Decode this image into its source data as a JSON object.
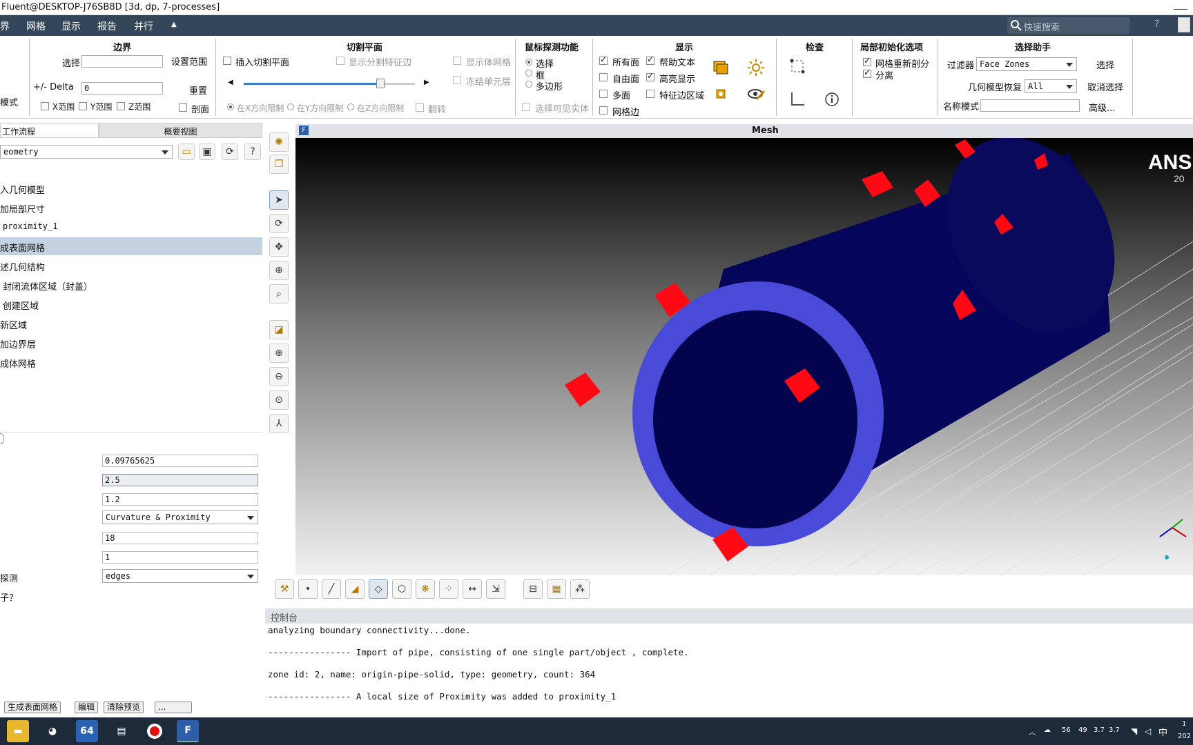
{
  "window": {
    "title": "Fluent@DESKTOP-J76SB8D  [3d, dp, 7-processes]"
  },
  "menu": {
    "items": [
      "界",
      "网格",
      "显示",
      "报告",
      "并行"
    ],
    "search_placeholder": "快速搜索"
  },
  "ribbon": {
    "boundary": {
      "title": "边界",
      "select_label": "选择",
      "set_range": "设置范围",
      "delta_label": "+/- Delta",
      "delta_value": "0",
      "reset": "重置",
      "mode_label": "模式",
      "x_range": "X范围",
      "y_range": "Y范围",
      "z_range": "Z范围",
      "section": "剖面"
    },
    "cutplane": {
      "title": "切割平面",
      "insert": "插入切割平面",
      "show_feature": "显示分割特征边",
      "x_limit": "在X方向限制",
      "y_limit": "在Y方向限制",
      "z_limit": "在Z方向限制",
      "show_mesh": "显示体网格",
      "freeze": "冻结单元层",
      "flip": "翻转",
      "slider_value": 0.8
    },
    "probe": {
      "title": "鼠标探测功能",
      "select": "选择",
      "box": "框",
      "polygon": "多边形",
      "visible_only": "选择可见实体"
    },
    "display": {
      "title": "显示",
      "all_faces": "所有面",
      "free_faces": "自由面",
      "multi_faces": "多面",
      "mesh_edges": "网格边",
      "help_text": "帮助文本",
      "highlight": "高亮显示",
      "feature_edges": "特征边区域"
    },
    "check": {
      "title": "检查"
    },
    "local_init": {
      "title": "局部初始化选项",
      "remesh": "网格重新剖分",
      "separate": "分离"
    },
    "selection_helper": {
      "title": "选择助手",
      "filter_label": "过滤器",
      "filter_value": "Face Zones",
      "select_btn": "选择",
      "geom_restore_label": "几何模型恢复",
      "geom_restore_value": "All",
      "deselect_btn": "取消选择",
      "name_mode_label": "名称模式",
      "advanced_btn": "高级..."
    }
  },
  "left": {
    "tab_workflow": "工作流程",
    "tab_overview": "概要视图",
    "workflow_select": "eometry",
    "tree": [
      "入几何模型",
      "加局部尺寸",
      "proximity_1",
      "成表面网格",
      "述几何结构",
      "封闭流体区域（封盖）",
      "创建区域",
      "新区域",
      "加边界层",
      "成体网格"
    ],
    "fields": [
      "0.09765625",
      "2.5",
      "1.2",
      "Curvature & Proximity",
      "18",
      "1",
      "edges"
    ],
    "label_probe": "探测",
    "label_q": "子？",
    "buttons": [
      "生成表面网格",
      "编辑",
      "清除预览",
      "..."
    ]
  },
  "viewport": {
    "title": "Mesh",
    "logo": "ANS",
    "logo_sub": "20"
  },
  "console": {
    "title": "控制台",
    "lines": [
      "analyzing boundary connectivity...done.",
      "---------------- Import of pipe, consisting of one single part/object , complete.",
      "zone id: 2, name: origin-pipe-solid, type: geometry, count: 364",
      "---------------- A local size of Proximity was added to proximity_1"
    ]
  },
  "taskbar": {
    "tray": [
      "56",
      "49",
      "3.7",
      "3.7",
      "中"
    ],
    "clock_top": "1",
    "clock_bottom": "202",
    "app_64": "64",
    "app_f": "F"
  }
}
